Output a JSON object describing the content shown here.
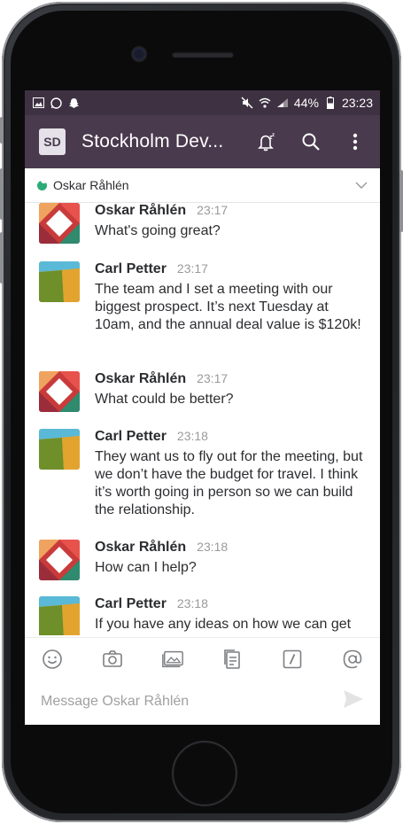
{
  "status_bar": {
    "left_icons": [
      "image-icon",
      "whatsapp-icon",
      "snapchat-icon"
    ],
    "battery_pct": "44%",
    "time": "23:23"
  },
  "app_bar": {
    "workspace_badge": "SD",
    "title": "Stockholm Dev...",
    "actions": [
      "snooze-bell-icon",
      "search-icon",
      "more-vert-icon"
    ]
  },
  "subheader": {
    "name": "Oskar Råhlén"
  },
  "messages": [
    {
      "author": "Oskar Råhlén",
      "time": "23:17",
      "text": "What's going great?",
      "avatar": "oskar"
    },
    {
      "author": "Carl Petter",
      "time": "23:17",
      "text": "The team and I set a meeting with our biggest prospect. It’s next Tuesday at 10am, and the annual deal value is $120k!",
      "avatar": "carl"
    },
    {
      "author": "Oskar Råhlén",
      "time": "23:17",
      "text": "What could be better?",
      "avatar": "oskar"
    },
    {
      "author": "Carl Petter",
      "time": "23:18",
      "text": "They want us to fly out for the meeting, but we don’t have the budget for travel. I think it’s worth going in person so we can build the relationship.",
      "avatar": "carl"
    },
    {
      "author": "Oskar Råhlén",
      "time": "23:18",
      "text": "How can I help?",
      "avatar": "oskar"
    },
    {
      "author": "Carl Petter",
      "time": "23:18",
      "text": "If you have any ideas on how we can get",
      "avatar": "carl"
    }
  ],
  "toolbar": [
    "emoji-icon",
    "camera-icon",
    "photos-icon",
    "files-icon",
    "slash-command-icon",
    "mention-icon"
  ],
  "composer": {
    "placeholder": "Message Oskar Råhlén"
  }
}
